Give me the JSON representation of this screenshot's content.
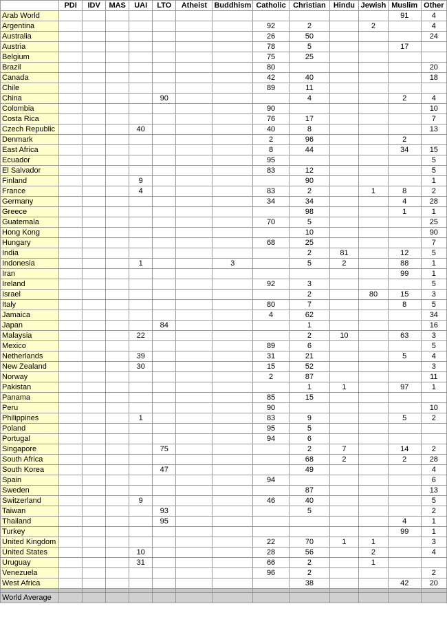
{
  "headers": {
    "country": "",
    "pdi": "PDI",
    "idv": "IDV",
    "mas": "MAS",
    "uai": "UAI",
    "lto": "LTO",
    "atheist": "Atheist",
    "buddhism": "Buddhism",
    "catholic": "Catholic",
    "christian": "Christian",
    "hindu": "Hindu",
    "jewish": "Jewish",
    "muslim": "Muslim",
    "other": "Other"
  },
  "rows": [
    {
      "country": "Arab World",
      "pdi": "",
      "idv": "",
      "mas": "",
      "uai": "",
      "lto": "",
      "atheist": "",
      "buddhism": "",
      "catholic": "",
      "christian": "",
      "hindu": "",
      "jewish": "",
      "muslim": "91",
      "other": "4"
    },
    {
      "country": "Argentina",
      "pdi": "",
      "idv": "",
      "mas": "",
      "uai": "",
      "lto": "",
      "atheist": "",
      "buddhism": "",
      "catholic": "92",
      "christian": "2",
      "hindu": "",
      "jewish": "2",
      "muslim": "",
      "other": "4"
    },
    {
      "country": "Australia",
      "pdi": "",
      "idv": "",
      "mas": "",
      "uai": "",
      "lto": "",
      "atheist": "",
      "buddhism": "",
      "catholic": "26",
      "christian": "50",
      "hindu": "",
      "jewish": "",
      "muslim": "",
      "other": "24"
    },
    {
      "country": "Austria",
      "pdi": "",
      "idv": "",
      "mas": "",
      "uai": "",
      "lto": "",
      "atheist": "",
      "buddhism": "",
      "catholic": "78",
      "christian": "5",
      "hindu": "",
      "jewish": "",
      "muslim": "17",
      "other": ""
    },
    {
      "country": "Belgium",
      "pdi": "",
      "idv": "",
      "mas": "",
      "uai": "",
      "lto": "",
      "atheist": "",
      "buddhism": "",
      "catholic": "75",
      "christian": "25",
      "hindu": "",
      "jewish": "",
      "muslim": "",
      "other": ""
    },
    {
      "country": "Brazil",
      "pdi": "",
      "idv": "",
      "mas": "",
      "uai": "",
      "lto": "",
      "atheist": "",
      "buddhism": "",
      "catholic": "80",
      "christian": "",
      "hindu": "",
      "jewish": "",
      "muslim": "",
      "other": "20"
    },
    {
      "country": "Canada",
      "pdi": "",
      "idv": "",
      "mas": "",
      "uai": "",
      "lto": "",
      "atheist": "",
      "buddhism": "",
      "catholic": "42",
      "christian": "40",
      "hindu": "",
      "jewish": "",
      "muslim": "",
      "other": "18"
    },
    {
      "country": "Chile",
      "pdi": "",
      "idv": "",
      "mas": "",
      "uai": "",
      "lto": "",
      "atheist": "",
      "buddhism": "",
      "catholic": "89",
      "christian": "11",
      "hindu": "",
      "jewish": "",
      "muslim": "",
      "other": ""
    },
    {
      "country": "China",
      "pdi": "",
      "idv": "",
      "mas": "",
      "uai": "",
      "lto": "90",
      "atheist": "",
      "buddhism": "",
      "catholic": "",
      "christian": "4",
      "hindu": "",
      "jewish": "",
      "muslim": "2",
      "other": "4"
    },
    {
      "country": "Colombia",
      "pdi": "",
      "idv": "",
      "mas": "",
      "uai": "",
      "lto": "",
      "atheist": "",
      "buddhism": "",
      "catholic": "90",
      "christian": "",
      "hindu": "",
      "jewish": "",
      "muslim": "",
      "other": "10"
    },
    {
      "country": "Costa Rica",
      "pdi": "",
      "idv": "",
      "mas": "",
      "uai": "",
      "lto": "",
      "atheist": "",
      "buddhism": "",
      "catholic": "76",
      "christian": "17",
      "hindu": "",
      "jewish": "",
      "muslim": "",
      "other": "7"
    },
    {
      "country": "Czech Republic",
      "pdi": "",
      "idv": "",
      "mas": "",
      "uai": "40",
      "lto": "",
      "atheist": "",
      "buddhism": "",
      "catholic": "40",
      "christian": "8",
      "hindu": "",
      "jewish": "",
      "muslim": "",
      "other": "13"
    },
    {
      "country": "Denmark",
      "pdi": "",
      "idv": "",
      "mas": "",
      "uai": "",
      "lto": "",
      "atheist": "",
      "buddhism": "",
      "catholic": "2",
      "christian": "96",
      "hindu": "",
      "jewish": "",
      "muslim": "2",
      "other": ""
    },
    {
      "country": "East Africa",
      "pdi": "",
      "idv": "",
      "mas": "",
      "uai": "",
      "lto": "",
      "atheist": "",
      "buddhism": "",
      "catholic": "8",
      "christian": "44",
      "hindu": "",
      "jewish": "",
      "muslim": "34",
      "other": "15"
    },
    {
      "country": "Ecuador",
      "pdi": "",
      "idv": "",
      "mas": "",
      "uai": "",
      "lto": "",
      "atheist": "",
      "buddhism": "",
      "catholic": "95",
      "christian": "",
      "hindu": "",
      "jewish": "",
      "muslim": "",
      "other": "5"
    },
    {
      "country": "El Salvador",
      "pdi": "",
      "idv": "",
      "mas": "",
      "uai": "",
      "lto": "",
      "atheist": "",
      "buddhism": "",
      "catholic": "83",
      "christian": "12",
      "hindu": "",
      "jewish": "",
      "muslim": "",
      "other": "5"
    },
    {
      "country": "Finland",
      "pdi": "",
      "idv": "",
      "mas": "",
      "uai": "9",
      "lto": "",
      "atheist": "",
      "buddhism": "",
      "catholic": "",
      "christian": "90",
      "hindu": "",
      "jewish": "",
      "muslim": "",
      "other": "1"
    },
    {
      "country": "France",
      "pdi": "",
      "idv": "",
      "mas": "",
      "uai": "4",
      "lto": "",
      "atheist": "",
      "buddhism": "",
      "catholic": "83",
      "christian": "2",
      "hindu": "",
      "jewish": "1",
      "muslim": "8",
      "other": "2"
    },
    {
      "country": "Germany",
      "pdi": "",
      "idv": "",
      "mas": "",
      "uai": "",
      "lto": "",
      "atheist": "",
      "buddhism": "",
      "catholic": "34",
      "christian": "34",
      "hindu": "",
      "jewish": "",
      "muslim": "4",
      "other": "28"
    },
    {
      "country": "Greece",
      "pdi": "",
      "idv": "",
      "mas": "",
      "uai": "",
      "lto": "",
      "atheist": "",
      "buddhism": "",
      "catholic": "",
      "christian": "98",
      "hindu": "",
      "jewish": "",
      "muslim": "1",
      "other": "1"
    },
    {
      "country": "Guatemala",
      "pdi": "",
      "idv": "",
      "mas": "",
      "uai": "",
      "lto": "",
      "atheist": "",
      "buddhism": "",
      "catholic": "70",
      "christian": "5",
      "hindu": "",
      "jewish": "",
      "muslim": "",
      "other": "25"
    },
    {
      "country": "Hong Kong",
      "pdi": "",
      "idv": "",
      "mas": "",
      "uai": "",
      "lto": "",
      "atheist": "",
      "buddhism": "",
      "catholic": "",
      "christian": "10",
      "hindu": "",
      "jewish": "",
      "muslim": "",
      "other": "90"
    },
    {
      "country": "Hungary",
      "pdi": "",
      "idv": "",
      "mas": "",
      "uai": "",
      "lto": "",
      "atheist": "",
      "buddhism": "",
      "catholic": "68",
      "christian": "25",
      "hindu": "",
      "jewish": "",
      "muslim": "",
      "other": "7"
    },
    {
      "country": "India",
      "pdi": "",
      "idv": "",
      "mas": "",
      "uai": "",
      "lto": "",
      "atheist": "",
      "buddhism": "",
      "catholic": "",
      "christian": "2",
      "hindu": "81",
      "jewish": "",
      "muslim": "12",
      "other": "5"
    },
    {
      "country": "Indonesia",
      "pdi": "",
      "idv": "",
      "mas": "",
      "uai": "1",
      "lto": "",
      "atheist": "",
      "buddhism": "3",
      "catholic": "",
      "christian": "5",
      "hindu": "2",
      "jewish": "",
      "muslim": "88",
      "other": "1"
    },
    {
      "country": "Iran",
      "pdi": "",
      "idv": "",
      "mas": "",
      "uai": "",
      "lto": "",
      "atheist": "",
      "buddhism": "",
      "catholic": "",
      "christian": "",
      "hindu": "",
      "jewish": "",
      "muslim": "99",
      "other": "1"
    },
    {
      "country": "Ireland",
      "pdi": "",
      "idv": "",
      "mas": "",
      "uai": "",
      "lto": "",
      "atheist": "",
      "buddhism": "",
      "catholic": "92",
      "christian": "3",
      "hindu": "",
      "jewish": "",
      "muslim": "",
      "other": "5"
    },
    {
      "country": "Israel",
      "pdi": "",
      "idv": "",
      "mas": "",
      "uai": "",
      "lto": "",
      "atheist": "",
      "buddhism": "",
      "catholic": "",
      "christian": "2",
      "hindu": "",
      "jewish": "80",
      "muslim": "15",
      "other": "3"
    },
    {
      "country": "Italy",
      "pdi": "",
      "idv": "",
      "mas": "",
      "uai": "",
      "lto": "",
      "atheist": "",
      "buddhism": "",
      "catholic": "80",
      "christian": "7",
      "hindu": "",
      "jewish": "",
      "muslim": "8",
      "other": "5"
    },
    {
      "country": "Jamaica",
      "pdi": "",
      "idv": "",
      "mas": "",
      "uai": "",
      "lto": "",
      "atheist": "",
      "buddhism": "",
      "catholic": "4",
      "christian": "62",
      "hindu": "",
      "jewish": "",
      "muslim": "",
      "other": "34"
    },
    {
      "country": "Japan",
      "pdi": "",
      "idv": "",
      "mas": "",
      "uai": "",
      "lto": "84",
      "atheist": "",
      "buddhism": "",
      "catholic": "",
      "christian": "1",
      "hindu": "",
      "jewish": "",
      "muslim": "",
      "other": "16"
    },
    {
      "country": "Malaysia",
      "pdi": "",
      "idv": "",
      "mas": "",
      "uai": "22",
      "lto": "",
      "atheist": "",
      "buddhism": "",
      "catholic": "",
      "christian": "2",
      "hindu": "10",
      "jewish": "",
      "muslim": "63",
      "other": "3"
    },
    {
      "country": "Mexico",
      "pdi": "",
      "idv": "",
      "mas": "",
      "uai": "",
      "lto": "",
      "atheist": "",
      "buddhism": "",
      "catholic": "89",
      "christian": "6",
      "hindu": "",
      "jewish": "",
      "muslim": "",
      "other": "5"
    },
    {
      "country": "Netherlands",
      "pdi": "",
      "idv": "",
      "mas": "",
      "uai": "39",
      "lto": "",
      "atheist": "",
      "buddhism": "",
      "catholic": "31",
      "christian": "21",
      "hindu": "",
      "jewish": "",
      "muslim": "5",
      "other": "4"
    },
    {
      "country": "New Zealand",
      "pdi": "",
      "idv": "",
      "mas": "",
      "uai": "30",
      "lto": "",
      "atheist": "",
      "buddhism": "",
      "catholic": "15",
      "christian": "52",
      "hindu": "",
      "jewish": "",
      "muslim": "",
      "other": "3"
    },
    {
      "country": "Norway",
      "pdi": "",
      "idv": "",
      "mas": "",
      "uai": "",
      "lto": "",
      "atheist": "",
      "buddhism": "",
      "catholic": "2",
      "christian": "87",
      "hindu": "",
      "jewish": "",
      "muslim": "",
      "other": "11"
    },
    {
      "country": "Pakistan",
      "pdi": "",
      "idv": "",
      "mas": "",
      "uai": "",
      "lto": "",
      "atheist": "",
      "buddhism": "",
      "catholic": "",
      "christian": "1",
      "hindu": "1",
      "jewish": "",
      "muslim": "97",
      "other": "1"
    },
    {
      "country": "Panama",
      "pdi": "",
      "idv": "",
      "mas": "",
      "uai": "",
      "lto": "",
      "atheist": "",
      "buddhism": "",
      "catholic": "85",
      "christian": "15",
      "hindu": "",
      "jewish": "",
      "muslim": "",
      "other": ""
    },
    {
      "country": "Peru",
      "pdi": "",
      "idv": "",
      "mas": "",
      "uai": "",
      "lto": "",
      "atheist": "",
      "buddhism": "",
      "catholic": "90",
      "christian": "",
      "hindu": "",
      "jewish": "",
      "muslim": "",
      "other": "10"
    },
    {
      "country": "Philippines",
      "pdi": "",
      "idv": "",
      "mas": "",
      "uai": "1",
      "lto": "",
      "atheist": "",
      "buddhism": "",
      "catholic": "83",
      "christian": "9",
      "hindu": "",
      "jewish": "",
      "muslim": "5",
      "other": "2"
    },
    {
      "country": "Poland",
      "pdi": "",
      "idv": "",
      "mas": "",
      "uai": "",
      "lto": "",
      "atheist": "",
      "buddhism": "",
      "catholic": "95",
      "christian": "5",
      "hindu": "",
      "jewish": "",
      "muslim": "",
      "other": ""
    },
    {
      "country": "Portugal",
      "pdi": "",
      "idv": "",
      "mas": "",
      "uai": "",
      "lto": "",
      "atheist": "",
      "buddhism": "",
      "catholic": "94",
      "christian": "6",
      "hindu": "",
      "jewish": "",
      "muslim": "",
      "other": ""
    },
    {
      "country": "Singapore",
      "pdi": "",
      "idv": "",
      "mas": "",
      "uai": "",
      "lto": "75",
      "atheist": "",
      "buddhism": "",
      "catholic": "",
      "christian": "2",
      "hindu": "7",
      "jewish": "",
      "muslim": "14",
      "other": "2"
    },
    {
      "country": "South Africa",
      "pdi": "",
      "idv": "",
      "mas": "",
      "uai": "",
      "lto": "",
      "atheist": "",
      "buddhism": "",
      "catholic": "",
      "christian": "68",
      "hindu": "2",
      "jewish": "",
      "muslim": "2",
      "other": "28"
    },
    {
      "country": "South Korea",
      "pdi": "",
      "idv": "",
      "mas": "",
      "uai": "",
      "lto": "47",
      "atheist": "",
      "buddhism": "",
      "catholic": "",
      "christian": "49",
      "hindu": "",
      "jewish": "",
      "muslim": "",
      "other": "4"
    },
    {
      "country": "Spain",
      "pdi": "",
      "idv": "",
      "mas": "",
      "uai": "",
      "lto": "",
      "atheist": "",
      "buddhism": "",
      "catholic": "94",
      "christian": "",
      "hindu": "",
      "jewish": "",
      "muslim": "",
      "other": "6"
    },
    {
      "country": "Sweden",
      "pdi": "",
      "idv": "",
      "mas": "",
      "uai": "",
      "lto": "",
      "atheist": "",
      "buddhism": "",
      "catholic": "",
      "christian": "87",
      "hindu": "",
      "jewish": "",
      "muslim": "",
      "other": "13"
    },
    {
      "country": "Switzerland",
      "pdi": "",
      "idv": "",
      "mas": "",
      "uai": "9",
      "lto": "",
      "atheist": "",
      "buddhism": "",
      "catholic": "46",
      "christian": "40",
      "hindu": "",
      "jewish": "",
      "muslim": "",
      "other": "5"
    },
    {
      "country": "Taiwan",
      "pdi": "",
      "idv": "",
      "mas": "",
      "uai": "",
      "lto": "93",
      "atheist": "",
      "buddhism": "",
      "catholic": "",
      "christian": "5",
      "hindu": "",
      "jewish": "",
      "muslim": "",
      "other": "2"
    },
    {
      "country": "Thailand",
      "pdi": "",
      "idv": "",
      "mas": "",
      "uai": "",
      "lto": "95",
      "atheist": "",
      "buddhism": "",
      "catholic": "",
      "christian": "",
      "hindu": "",
      "jewish": "",
      "muslim": "4",
      "other": "1"
    },
    {
      "country": "Turkey",
      "pdi": "",
      "idv": "",
      "mas": "",
      "uai": "",
      "lto": "",
      "atheist": "",
      "buddhism": "",
      "catholic": "",
      "christian": "",
      "hindu": "",
      "jewish": "",
      "muslim": "99",
      "other": "1"
    },
    {
      "country": "United Kingdom",
      "pdi": "",
      "idv": "",
      "mas": "",
      "uai": "",
      "lto": "",
      "atheist": "",
      "buddhism": "",
      "catholic": "22",
      "christian": "70",
      "hindu": "1",
      "jewish": "1",
      "muslim": "",
      "other": "3"
    },
    {
      "country": "United States",
      "pdi": "",
      "idv": "",
      "mas": "",
      "uai": "10",
      "lto": "",
      "atheist": "",
      "buddhism": "",
      "catholic": "28",
      "christian": "56",
      "hindu": "",
      "jewish": "2",
      "muslim": "",
      "other": "4"
    },
    {
      "country": "Uruguay",
      "pdi": "",
      "idv": "",
      "mas": "",
      "uai": "31",
      "lto": "",
      "atheist": "",
      "buddhism": "",
      "catholic": "66",
      "christian": "2",
      "hindu": "",
      "jewish": "1",
      "muslim": "",
      "other": ""
    },
    {
      "country": "Venezuela",
      "pdi": "",
      "idv": "",
      "mas": "",
      "uai": "",
      "lto": "",
      "atheist": "",
      "buddhism": "",
      "catholic": "96",
      "christian": "2",
      "hindu": "",
      "jewish": "",
      "muslim": "",
      "other": "2"
    },
    {
      "country": "West Africa",
      "pdi": "",
      "idv": "",
      "mas": "",
      "uai": "",
      "lto": "",
      "atheist": "",
      "buddhism": "",
      "catholic": "",
      "christian": "38",
      "hindu": "",
      "jewish": "",
      "muslim": "42",
      "other": "20"
    }
  ],
  "world_average": {
    "country": "World Average",
    "pdi": "",
    "idv": "",
    "mas": "",
    "uai": "",
    "lto": "",
    "atheist": "",
    "buddhism": "",
    "catholic": "",
    "christian": "",
    "hindu": "",
    "jewish": "",
    "muslim": "",
    "other": ""
  }
}
